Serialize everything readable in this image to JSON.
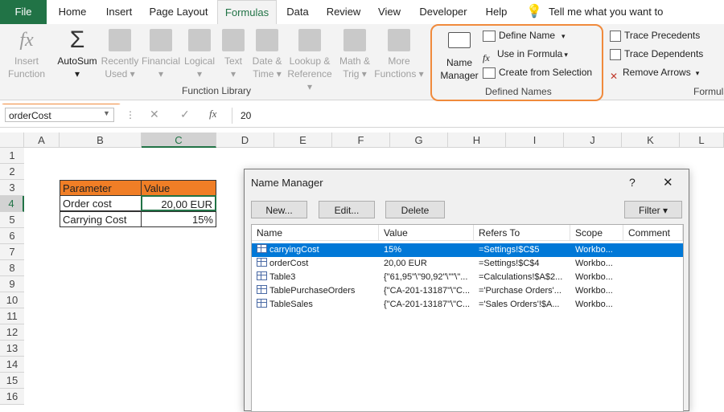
{
  "tabs": [
    "File",
    "Home",
    "Insert",
    "Page Layout",
    "Formulas",
    "Data",
    "Review",
    "View",
    "Developer",
    "Help"
  ],
  "tell_me": "Tell me what you want to do",
  "function_library": {
    "buttons": [
      {
        "label1": "Insert",
        "label2": "Function"
      },
      {
        "label1": "AutoSum",
        "label2": "▾"
      },
      {
        "label1": "Recently",
        "label2": "Used ▾"
      },
      {
        "label1": "Financial",
        "label2": "▾"
      },
      {
        "label1": "Logical",
        "label2": "▾"
      },
      {
        "label1": "Text",
        "label2": "▾"
      },
      {
        "label1": "Date &",
        "label2": "Time ▾"
      },
      {
        "label1": "Lookup &",
        "label2": "Reference ▾"
      },
      {
        "label1": "Math &",
        "label2": "Trig ▾"
      },
      {
        "label1": "More",
        "label2": "Functions ▾"
      }
    ],
    "group_label": "Function Library"
  },
  "defined_names": {
    "name_manager1": "Name",
    "name_manager2": "Manager",
    "define_name": "Define Name",
    "use_in_formula": "Use in Formula",
    "create_from_selection": "Create from Selection",
    "group_label": "Defined Names"
  },
  "formula_auditing": {
    "trace_precedents": "Trace Precedents",
    "trace_dependents": "Trace Dependents",
    "remove_arrows": "Remove Arrows",
    "group_label": "Formula"
  },
  "formula_bar": {
    "name_box": "orderCost",
    "value": "20"
  },
  "columns": [
    "A",
    "B",
    "C",
    "D",
    "E",
    "F",
    "G",
    "H",
    "I",
    "J",
    "K",
    "L"
  ],
  "rows": [
    "1",
    "2",
    "3",
    "4",
    "5",
    "6",
    "7",
    "8",
    "9",
    "10",
    "11",
    "12",
    "13",
    "14",
    "15",
    "16"
  ],
  "sheet": {
    "header_param": "Parameter",
    "header_value": "Value",
    "row1_label": "Order cost",
    "row1_value": "20,00 EUR",
    "row2_label": "Carrying Cost",
    "row2_value": "15%"
  },
  "dialog": {
    "title": "Name Manager",
    "help": "?",
    "close": "✕",
    "new": "New...",
    "edit": "Edit...",
    "delete": "Delete",
    "filter": "Filter ▾",
    "headers": [
      "Name",
      "Value",
      "Refers To",
      "Scope",
      "Comment"
    ],
    "rows": [
      {
        "name": "carryingCost",
        "value": "15%",
        "refers": "=Settings!$C$5",
        "scope": "Workbo...",
        "comment": ""
      },
      {
        "name": "orderCost",
        "value": "20,00 EUR",
        "refers": "=Settings!$C$4",
        "scope": "Workbo...",
        "comment": ""
      },
      {
        "name": "Table3",
        "value": "{\"61,95\"\\\"90,92\"\\\"\"\\\"...",
        "refers": "=Calculations!$A$2...",
        "scope": "Workbo...",
        "comment": ""
      },
      {
        "name": "TablePurchaseOrders",
        "value": "{\"CA-201-13187\"\\\"C...",
        "refers": "='Purchase Orders'...",
        "scope": "Workbo...",
        "comment": ""
      },
      {
        "name": "TableSales",
        "value": "{\"CA-201-13187\"\\\"C...",
        "refers": "='Sales Orders'!$A...",
        "scope": "Workbo...",
        "comment": ""
      }
    ]
  },
  "colors": {
    "excel_green": "#217346",
    "orange_header": "#f07e26",
    "highlight_orange": "#f08a3c",
    "selection_blue": "#0078d7"
  }
}
